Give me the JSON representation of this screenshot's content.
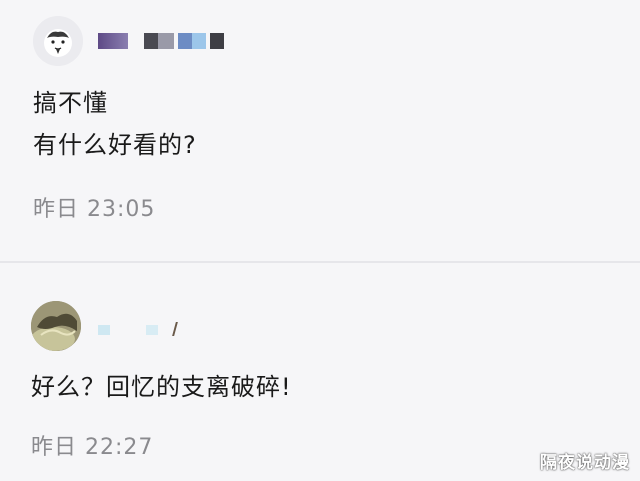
{
  "comments": [
    {
      "avatar_icon": "white-dog-avatar-icon",
      "lines": [
        "搞不懂",
        "有什么好看的?"
      ],
      "timestamp": "昨日 23:05"
    },
    {
      "avatar_icon": "landscape-photo-avatar-icon",
      "lines": [
        "好么？回忆的支离破碎!"
      ],
      "timestamp": "昨日 22:27"
    }
  ],
  "watermark": "隔夜说动漫"
}
